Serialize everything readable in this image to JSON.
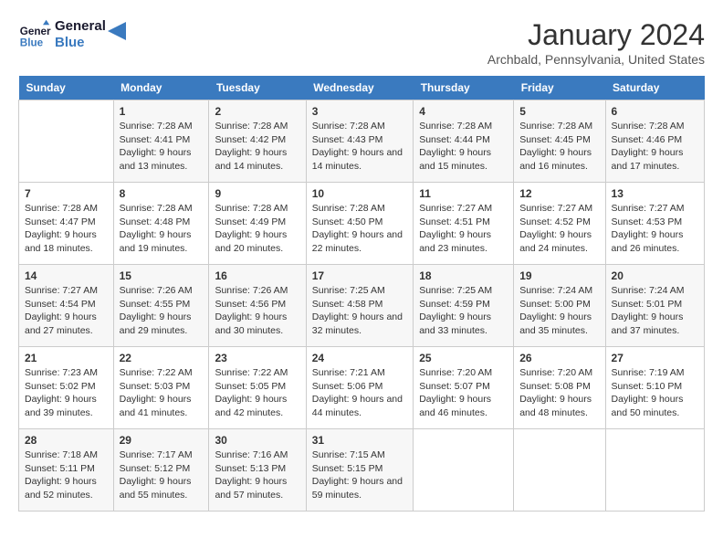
{
  "header": {
    "logo_line1": "General",
    "logo_line2": "Blue",
    "month": "January 2024",
    "location": "Archbald, Pennsylvania, United States"
  },
  "days_of_week": [
    "Sunday",
    "Monday",
    "Tuesday",
    "Wednesday",
    "Thursday",
    "Friday",
    "Saturday"
  ],
  "weeks": [
    [
      {
        "day": "",
        "sunrise": "",
        "sunset": "",
        "daylight": ""
      },
      {
        "day": "1",
        "sunrise": "Sunrise: 7:28 AM",
        "sunset": "Sunset: 4:41 PM",
        "daylight": "Daylight: 9 hours and 13 minutes."
      },
      {
        "day": "2",
        "sunrise": "Sunrise: 7:28 AM",
        "sunset": "Sunset: 4:42 PM",
        "daylight": "Daylight: 9 hours and 14 minutes."
      },
      {
        "day": "3",
        "sunrise": "Sunrise: 7:28 AM",
        "sunset": "Sunset: 4:43 PM",
        "daylight": "Daylight: 9 hours and 14 minutes."
      },
      {
        "day": "4",
        "sunrise": "Sunrise: 7:28 AM",
        "sunset": "Sunset: 4:44 PM",
        "daylight": "Daylight: 9 hours and 15 minutes."
      },
      {
        "day": "5",
        "sunrise": "Sunrise: 7:28 AM",
        "sunset": "Sunset: 4:45 PM",
        "daylight": "Daylight: 9 hours and 16 minutes."
      },
      {
        "day": "6",
        "sunrise": "Sunrise: 7:28 AM",
        "sunset": "Sunset: 4:46 PM",
        "daylight": "Daylight: 9 hours and 17 minutes."
      }
    ],
    [
      {
        "day": "7",
        "sunrise": "Sunrise: 7:28 AM",
        "sunset": "Sunset: 4:47 PM",
        "daylight": "Daylight: 9 hours and 18 minutes."
      },
      {
        "day": "8",
        "sunrise": "Sunrise: 7:28 AM",
        "sunset": "Sunset: 4:48 PM",
        "daylight": "Daylight: 9 hours and 19 minutes."
      },
      {
        "day": "9",
        "sunrise": "Sunrise: 7:28 AM",
        "sunset": "Sunset: 4:49 PM",
        "daylight": "Daylight: 9 hours and 20 minutes."
      },
      {
        "day": "10",
        "sunrise": "Sunrise: 7:28 AM",
        "sunset": "Sunset: 4:50 PM",
        "daylight": "Daylight: 9 hours and 22 minutes."
      },
      {
        "day": "11",
        "sunrise": "Sunrise: 7:27 AM",
        "sunset": "Sunset: 4:51 PM",
        "daylight": "Daylight: 9 hours and 23 minutes."
      },
      {
        "day": "12",
        "sunrise": "Sunrise: 7:27 AM",
        "sunset": "Sunset: 4:52 PM",
        "daylight": "Daylight: 9 hours and 24 minutes."
      },
      {
        "day": "13",
        "sunrise": "Sunrise: 7:27 AM",
        "sunset": "Sunset: 4:53 PM",
        "daylight": "Daylight: 9 hours and 26 minutes."
      }
    ],
    [
      {
        "day": "14",
        "sunrise": "Sunrise: 7:27 AM",
        "sunset": "Sunset: 4:54 PM",
        "daylight": "Daylight: 9 hours and 27 minutes."
      },
      {
        "day": "15",
        "sunrise": "Sunrise: 7:26 AM",
        "sunset": "Sunset: 4:55 PM",
        "daylight": "Daylight: 9 hours and 29 minutes."
      },
      {
        "day": "16",
        "sunrise": "Sunrise: 7:26 AM",
        "sunset": "Sunset: 4:56 PM",
        "daylight": "Daylight: 9 hours and 30 minutes."
      },
      {
        "day": "17",
        "sunrise": "Sunrise: 7:25 AM",
        "sunset": "Sunset: 4:58 PM",
        "daylight": "Daylight: 9 hours and 32 minutes."
      },
      {
        "day": "18",
        "sunrise": "Sunrise: 7:25 AM",
        "sunset": "Sunset: 4:59 PM",
        "daylight": "Daylight: 9 hours and 33 minutes."
      },
      {
        "day": "19",
        "sunrise": "Sunrise: 7:24 AM",
        "sunset": "Sunset: 5:00 PM",
        "daylight": "Daylight: 9 hours and 35 minutes."
      },
      {
        "day": "20",
        "sunrise": "Sunrise: 7:24 AM",
        "sunset": "Sunset: 5:01 PM",
        "daylight": "Daylight: 9 hours and 37 minutes."
      }
    ],
    [
      {
        "day": "21",
        "sunrise": "Sunrise: 7:23 AM",
        "sunset": "Sunset: 5:02 PM",
        "daylight": "Daylight: 9 hours and 39 minutes."
      },
      {
        "day": "22",
        "sunrise": "Sunrise: 7:22 AM",
        "sunset": "Sunset: 5:03 PM",
        "daylight": "Daylight: 9 hours and 41 minutes."
      },
      {
        "day": "23",
        "sunrise": "Sunrise: 7:22 AM",
        "sunset": "Sunset: 5:05 PM",
        "daylight": "Daylight: 9 hours and 42 minutes."
      },
      {
        "day": "24",
        "sunrise": "Sunrise: 7:21 AM",
        "sunset": "Sunset: 5:06 PM",
        "daylight": "Daylight: 9 hours and 44 minutes."
      },
      {
        "day": "25",
        "sunrise": "Sunrise: 7:20 AM",
        "sunset": "Sunset: 5:07 PM",
        "daylight": "Daylight: 9 hours and 46 minutes."
      },
      {
        "day": "26",
        "sunrise": "Sunrise: 7:20 AM",
        "sunset": "Sunset: 5:08 PM",
        "daylight": "Daylight: 9 hours and 48 minutes."
      },
      {
        "day": "27",
        "sunrise": "Sunrise: 7:19 AM",
        "sunset": "Sunset: 5:10 PM",
        "daylight": "Daylight: 9 hours and 50 minutes."
      }
    ],
    [
      {
        "day": "28",
        "sunrise": "Sunrise: 7:18 AM",
        "sunset": "Sunset: 5:11 PM",
        "daylight": "Daylight: 9 hours and 52 minutes."
      },
      {
        "day": "29",
        "sunrise": "Sunrise: 7:17 AM",
        "sunset": "Sunset: 5:12 PM",
        "daylight": "Daylight: 9 hours and 55 minutes."
      },
      {
        "day": "30",
        "sunrise": "Sunrise: 7:16 AM",
        "sunset": "Sunset: 5:13 PM",
        "daylight": "Daylight: 9 hours and 57 minutes."
      },
      {
        "day": "31",
        "sunrise": "Sunrise: 7:15 AM",
        "sunset": "Sunset: 5:15 PM",
        "daylight": "Daylight: 9 hours and 59 minutes."
      },
      {
        "day": "",
        "sunrise": "",
        "sunset": "",
        "daylight": ""
      },
      {
        "day": "",
        "sunrise": "",
        "sunset": "",
        "daylight": ""
      },
      {
        "day": "",
        "sunrise": "",
        "sunset": "",
        "daylight": ""
      }
    ]
  ]
}
